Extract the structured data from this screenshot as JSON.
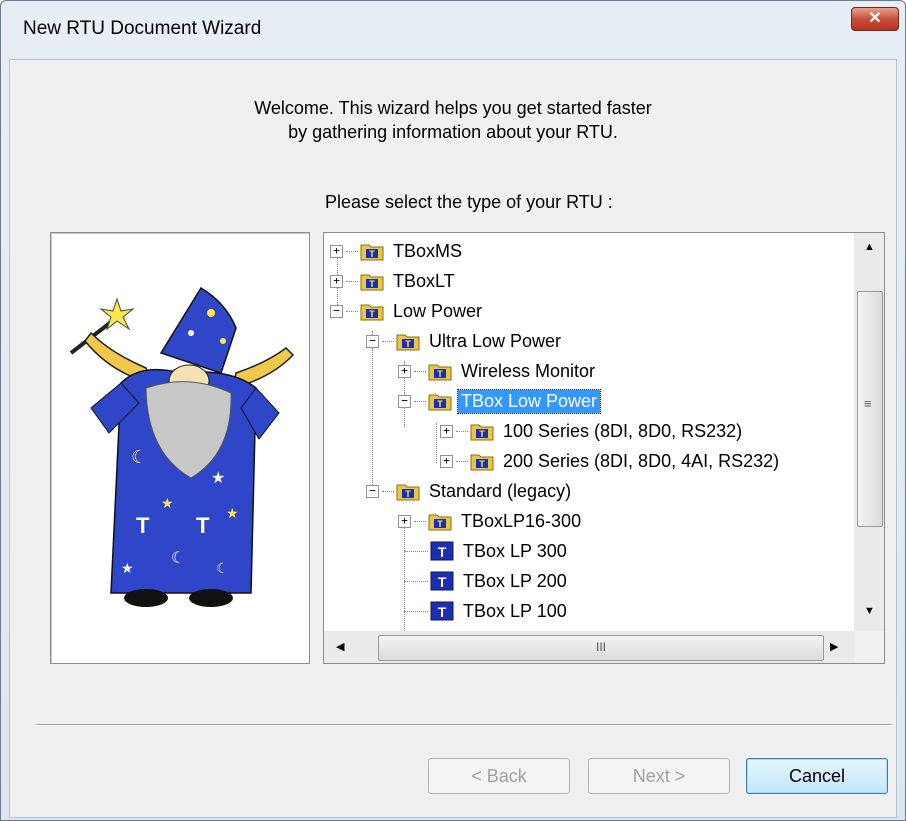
{
  "window": {
    "title": "New RTU Document Wizard",
    "close_glyph": "✕"
  },
  "welcome": {
    "line1": "Welcome.  This wizard helps you get started faster",
    "line2": "by gathering information about your RTU."
  },
  "prompt": "Please select the type of your RTU :",
  "tree": {
    "items": [
      {
        "label": "TBoxMS",
        "expander": "+",
        "icon": "folder-icon",
        "level": 0
      },
      {
        "label": "TBoxLT",
        "expander": "+",
        "icon": "folder-icon",
        "level": 0
      },
      {
        "label": "Low Power",
        "expander": "−",
        "icon": "folder-icon",
        "level": 0
      },
      {
        "label": "Ultra Low Power",
        "expander": "−",
        "icon": "folder-icon",
        "level": 1
      },
      {
        "label": "Wireless Monitor",
        "expander": "+",
        "icon": "folder-icon",
        "level": 2
      },
      {
        "label": "TBox Low Power",
        "expander": "−",
        "icon": "folder-icon",
        "level": 2,
        "selected": true
      },
      {
        "label": "100 Series (8DI, 8D0, RS232)",
        "expander": "+",
        "icon": "folder-icon",
        "level": 3
      },
      {
        "label": "200 Series (8DI, 8D0, 4AI, RS232)",
        "expander": "+",
        "icon": "folder-icon",
        "level": 3
      },
      {
        "label": "Standard (legacy)",
        "expander": "−",
        "icon": "folder-icon",
        "level": 1
      },
      {
        "label": "TBoxLP16-300",
        "expander": "+",
        "icon": "folder-icon",
        "level": 2
      },
      {
        "label": "TBox LP 300",
        "expander": "",
        "icon": "device-icon",
        "level": 2
      },
      {
        "label": "TBox LP 200",
        "expander": "",
        "icon": "device-icon",
        "level": 2
      },
      {
        "label": "TBox LP 100",
        "expander": "",
        "icon": "device-icon",
        "level": 2
      }
    ],
    "vscroll": {
      "up": "▲",
      "down": "▼",
      "grip": "≡"
    },
    "hscroll": {
      "left": "◀",
      "right": "▶",
      "grip": "III"
    }
  },
  "buttons": {
    "back": "< Back",
    "next": "Next >",
    "cancel": "Cancel"
  },
  "colors": {
    "selection": "#3399ff",
    "folder": "#e8c64a",
    "device": "#1b2fb0",
    "wizard_robe": "#2f46c8"
  }
}
